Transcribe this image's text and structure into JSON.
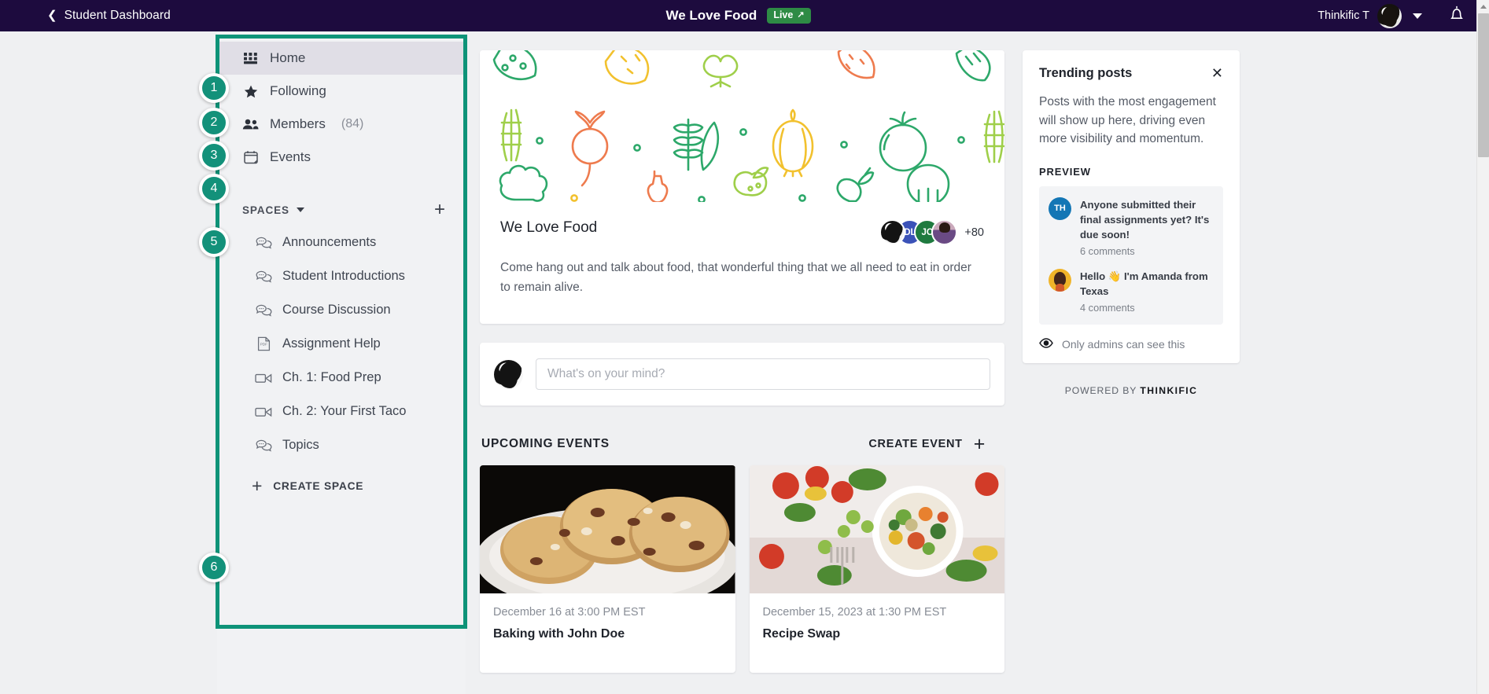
{
  "topbar": {
    "back_icon": "chevron-left-icon",
    "breadcrumb": "Student Dashboard",
    "site_title": "We Love Food",
    "live_label": "Live",
    "live_arrow": "↗",
    "user_name": "Thinkific T",
    "avatar_icon": "user-avatar",
    "caret_icon": "chevron-down-icon",
    "bell_icon": "notification-bell-icon"
  },
  "sidebar": {
    "nav": [
      {
        "label": "Home",
        "icon": "grid-icon",
        "active": true,
        "count": ""
      },
      {
        "label": "Following",
        "icon": "star-icon",
        "active": false,
        "count": ""
      },
      {
        "label": "Members",
        "icon": "people-icon",
        "active": false,
        "count": "(84)"
      },
      {
        "label": "Events",
        "icon": "calendar-icon",
        "active": false,
        "count": ""
      }
    ],
    "spaces_label": "SPACES",
    "spaces_caret_icon": "chevron-down-icon",
    "spaces_add_icon": "plus-icon",
    "spaces": [
      {
        "label": "Announcements",
        "icon": "chat-bubbles-icon"
      },
      {
        "label": "Student Introductions",
        "icon": "chat-bubbles-icon"
      },
      {
        "label": "Course Discussion",
        "icon": "chat-bubbles-icon"
      },
      {
        "label": "Assignment Help",
        "icon": "pdf-file-icon"
      },
      {
        "label": "Ch. 1: Food Prep",
        "icon": "video-camera-icon"
      },
      {
        "label": "Ch. 2: Your First Taco",
        "icon": "video-camera-icon"
      },
      {
        "label": "Topics",
        "icon": "chat-bubbles-icon"
      }
    ],
    "create_space_label": "CREATE SPACE",
    "create_space_icon": "plus-icon"
  },
  "annotations": {
    "box_color": "#0e9378",
    "bullet_color": "#13917a",
    "bullets": [
      "1",
      "2",
      "3",
      "4",
      "5",
      "6"
    ]
  },
  "main": {
    "banner_icon": "vegetable-pattern-banner",
    "community_title": "We Love Food",
    "avatars": [
      {
        "type": "photo",
        "initials": ""
      },
      {
        "type": "initials",
        "initials": "DL",
        "color": "#3b52b8"
      },
      {
        "type": "initials",
        "initials": "JC",
        "color": "#1f7a3f"
      },
      {
        "type": "photo",
        "initials": ""
      }
    ],
    "avatar_overflow": "+80",
    "description": "Come hang out and talk about food, that wonderful thing that we all need to eat in order to remain alive.",
    "composer_placeholder": "What's on your mind?",
    "composer_value": "",
    "events_heading": "UPCOMING EVENTS",
    "create_event_label": "CREATE EVENT",
    "create_event_icon": "plus-icon",
    "events": [
      {
        "date": "December 16 at 3:00 PM EST",
        "name": "Baking with John Doe",
        "image": "cookies-photo"
      },
      {
        "date": "December 15, 2023 at 1:30 PM EST",
        "name": "Recipe Swap",
        "image": "veggie-bowl-photo"
      }
    ]
  },
  "right_panel": {
    "title": "Trending posts",
    "close_icon": "close-icon",
    "description": "Posts with the most engagement will show up here, driving even more visibility and momentum.",
    "preview_label": "PREVIEW",
    "posts": [
      {
        "avatar_initials": "TH",
        "avatar_color": "#1376b5",
        "text": "Anyone submitted their final assignments yet? It's due soon!",
        "comments": "6 comments"
      },
      {
        "avatar_initials": "",
        "avatar_color": "#f0b429",
        "text": "Hello 👋 I'm Amanda from Texas",
        "comments": "4 comments"
      }
    ],
    "admins_icon": "eye-icon",
    "admins_note": "Only admins can see this",
    "powered_prefix": "POWERED BY",
    "powered_brand": "THINKIFIC"
  }
}
